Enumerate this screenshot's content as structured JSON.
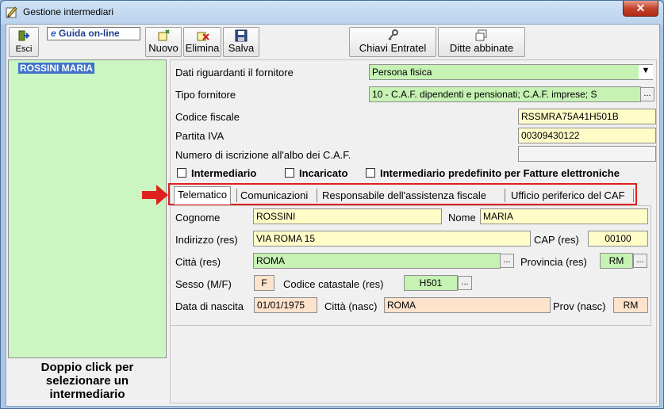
{
  "window": {
    "title": "Gestione intermediari",
    "close_glyph": "✕"
  },
  "toolbar": {
    "exit_label": "Esci",
    "help_label": "Guida on-line",
    "new_label": "Nuovo",
    "delete_label": "Elimina",
    "save_label": "Salva",
    "keys_label": "Chiavi Entratel",
    "companies_label": "Ditte abbinate"
  },
  "list": {
    "selected_item": "ROSSINI MARIA",
    "hint": "Doppio click per selezionare un intermediario"
  },
  "form": {
    "supplier_data_label": "Dati riguardanti il fornitore",
    "supplier_data_value": "Persona fisica",
    "supplier_type_label": "Tipo fornitore",
    "supplier_type_value": "10 - C.A.F. dipendenti e pensionati; C.A.F. imprese; S",
    "tax_code_label": "Codice fiscale",
    "tax_code_value": "RSSMRA75A41H501B",
    "vat_label": "Partita IVA",
    "vat_value": "00309430122",
    "caf_reg_label": "Numero di iscrizione all'albo dei C.A.F.",
    "caf_reg_value": "",
    "chk_intermediary": "Intermediario",
    "chk_appointee": "Incaricato",
    "chk_default": "Intermediario predefinito per Fatture elettroniche"
  },
  "tabs": [
    "Telematico",
    "Comunicazioni",
    "Responsabile dell'assistenza fiscale",
    "Ufficio periferico del CAF"
  ],
  "telematico": {
    "surname_label": "Cognome",
    "surname_value": "ROSSINI",
    "name_label": "Nome",
    "name_value": "MARIA",
    "address_label": "Indirizzo (res)",
    "address_value": "VIA ROMA 15",
    "cap_label": "CAP (res)",
    "cap_value": "00100",
    "city_label": "Città (res)",
    "city_value": "ROMA",
    "province_label": "Provincia (res)",
    "province_value": "RM",
    "sex_label": "Sesso (M/F)",
    "sex_value": "F",
    "cadastral_label": "Codice catastale (res)",
    "cadastral_value": "H501",
    "birth_date_label": "Data di nascita",
    "birth_date_value": "01/01/1975",
    "birth_city_label": "Città (nasc)",
    "birth_city_value": "ROMA",
    "birth_prov_label": "Prov (nasc)",
    "birth_prov_value": "RM"
  },
  "colors": {
    "highlight_frame": "#e0201e",
    "list_bg": "#ccf5c4",
    "selection": "#3f73c9"
  }
}
